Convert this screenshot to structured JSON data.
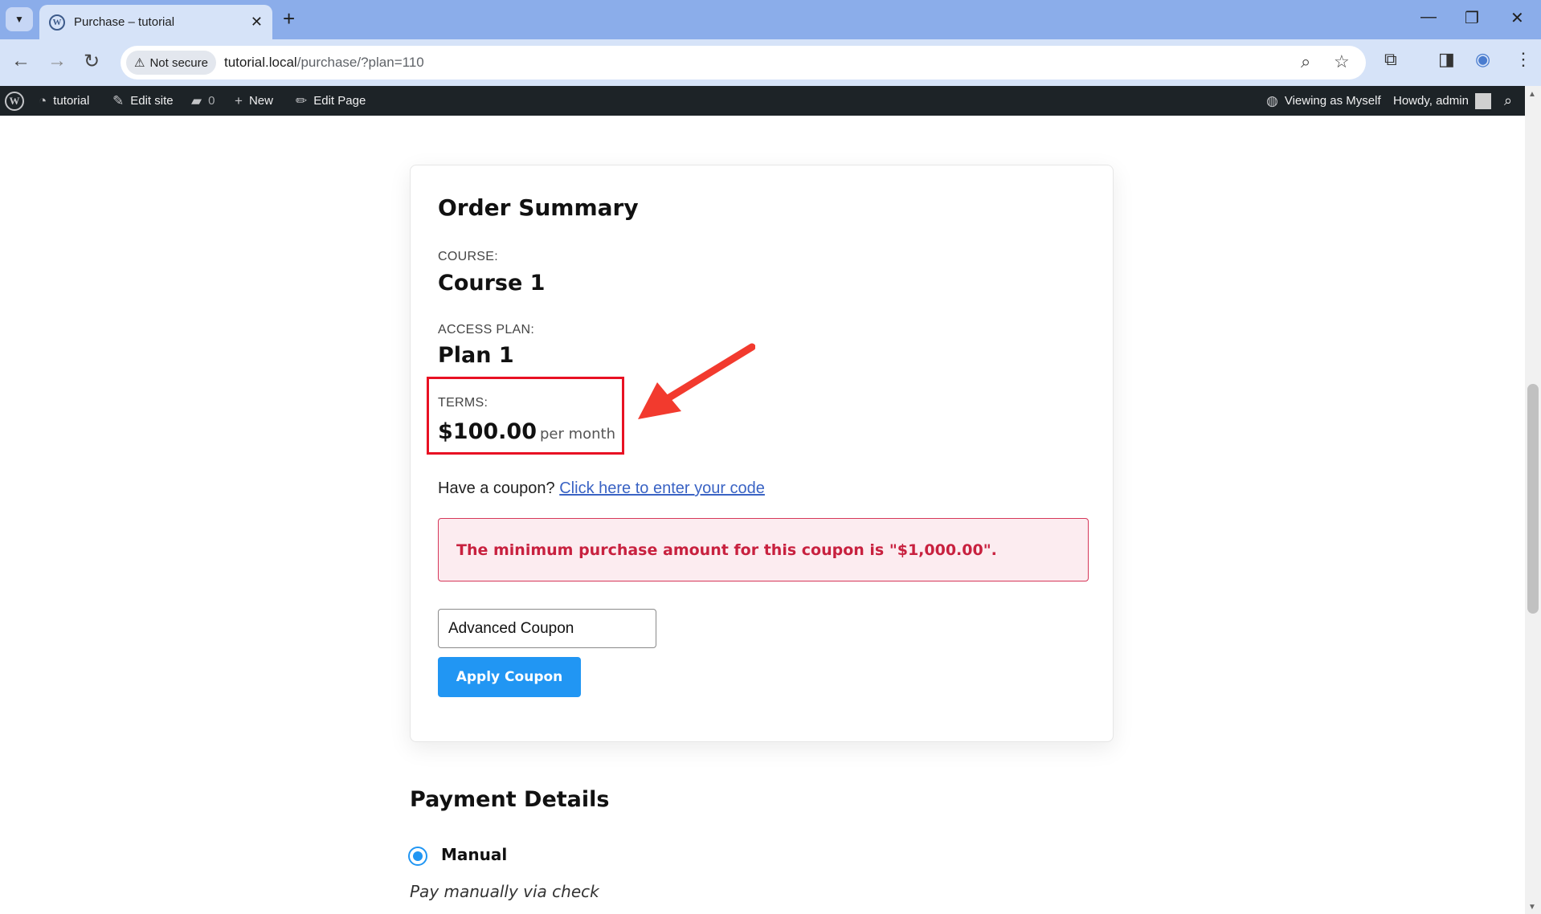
{
  "browser": {
    "tab_title": "Purchase – tutorial",
    "security_chip": "Not secure",
    "url_domain": "tutorial.local",
    "url_path": "/purchase/?plan=110"
  },
  "admin_bar": {
    "site_name": "tutorial",
    "edit_site": "Edit site",
    "comments_count": "0",
    "new_label": "New",
    "edit_page": "Edit Page",
    "viewing_as": "Viewing as Myself",
    "howdy": "Howdy, admin"
  },
  "order_summary": {
    "title": "Order Summary",
    "course_label": "COURSE:",
    "course_value": "Course 1",
    "plan_label": "ACCESS PLAN:",
    "plan_value": "Plan 1",
    "terms_label": "TERMS:",
    "terms_price": "$100.00",
    "terms_period": "per month",
    "coupon_prompt": "Have a coupon?",
    "coupon_link": "Click here to enter your code",
    "error_message": "The minimum purchase amount for this coupon is \"$1,000.00\".",
    "coupon_input_value": "Advanced Coupon",
    "apply_button": "Apply Coupon"
  },
  "payment": {
    "title": "Payment Details",
    "method_label": "Manual",
    "method_description": "Pay manually via check"
  },
  "colors": {
    "highlight": "#e81123",
    "accent": "#2196f3",
    "error": "#c8213f"
  }
}
